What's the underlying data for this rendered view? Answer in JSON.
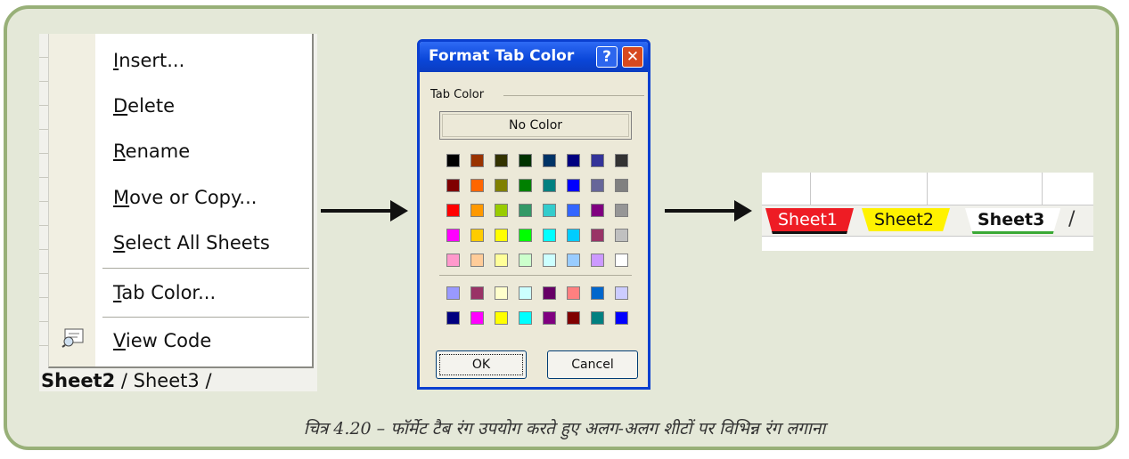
{
  "context_menu": {
    "items": [
      {
        "label": "Insert..."
      },
      {
        "label": "Delete"
      },
      {
        "label": "Rename"
      },
      {
        "label": "Move or Copy..."
      },
      {
        "label": "Select All Sheets"
      },
      {
        "label": "Tab Color..."
      },
      {
        "label": "View Code"
      }
    ],
    "sheet_tabs": [
      "Sheet2",
      "Sheet3"
    ]
  },
  "dialog": {
    "title": "Format Tab Color",
    "help_glyph": "?",
    "close_glyph": "✕",
    "group_label": "Tab Color",
    "no_color_label": "No Color",
    "ok_label": "OK",
    "cancel_label": "Cancel",
    "palette_main": [
      [
        "#000000",
        "#993300",
        "#333300",
        "#003300",
        "#003366",
        "#000080",
        "#333399",
        "#333333"
      ],
      [
        "#800000",
        "#ff6600",
        "#808000",
        "#008000",
        "#008080",
        "#0000ff",
        "#666699",
        "#808080"
      ],
      [
        "#ff0000",
        "#ff9900",
        "#99cc00",
        "#339966",
        "#33cccc",
        "#3366ff",
        "#800080",
        "#969696"
      ],
      [
        "#ff00ff",
        "#ffcc00",
        "#ffff00",
        "#00ff00",
        "#00ffff",
        "#00ccff",
        "#993366",
        "#c0c0c0"
      ],
      [
        "#ff99cc",
        "#ffcc99",
        "#ffff99",
        "#ccffcc",
        "#ccffff",
        "#99ccff",
        "#cc99ff",
        "#ffffff"
      ]
    ],
    "palette_extra": [
      [
        "#9999ff",
        "#993366",
        "#ffffcc",
        "#ccffff",
        "#660066",
        "#ff8080",
        "#0066cc",
        "#ccccff"
      ],
      [
        "#000080",
        "#ff00ff",
        "#ffff00",
        "#00ffff",
        "#800080",
        "#800000",
        "#008080",
        "#0000ff"
      ]
    ]
  },
  "result_tabs": [
    {
      "label": "Sheet1",
      "color": "#ee1c24"
    },
    {
      "label": "Sheet2",
      "color": "#fff200"
    },
    {
      "label": "Sheet3",
      "color": "#3aa935"
    }
  ],
  "caption": "चित्र 4.20 – फॉर्मेट टैब रंग उपयोग करते हुए अलग-अलग शीटों पर विभिन्न रंग लगाना"
}
